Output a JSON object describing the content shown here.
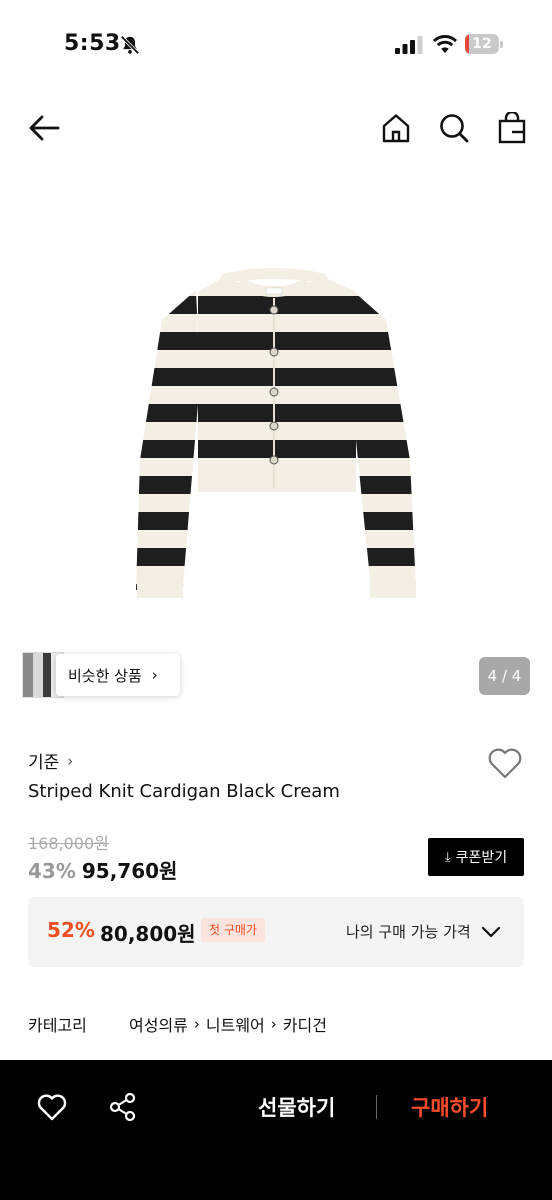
{
  "status_bar": {
    "time": "5:53",
    "battery": "12",
    "battery_fraction": 0.12,
    "battery_color": "#e2453c"
  },
  "nav": {
    "back_icon": "arrow-left-icon",
    "home_icon": "home-icon",
    "search_icon": "search-icon",
    "bag_icon": "shopping-bag-icon"
  },
  "gallery": {
    "similar_label": "비슷한 상품",
    "page_counter": "4 / 4"
  },
  "product": {
    "brand": "기준",
    "name": "Striped Knit Cardigan Black Cream",
    "original_price": "168,000원",
    "discount_rate": "43%",
    "sale_price": "95,760원",
    "coupon_label": "쿠폰받기"
  },
  "member_price": {
    "rate": "52%",
    "price": "80,800원",
    "badge": "첫 구매가",
    "my_price_label": "나의 구매 가능 가격",
    "accent_color": "#f04e23"
  },
  "category": {
    "label": "카테고리",
    "path": [
      "여성의류",
      "니트웨어",
      "카디건"
    ]
  },
  "bottom_bar": {
    "gift_label": "선물하기",
    "buy_label": "구매하기",
    "buy_color": "#ff4b2e"
  }
}
